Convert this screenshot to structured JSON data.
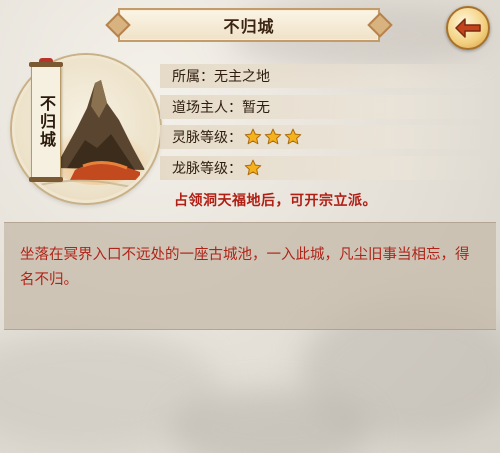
{
  "title": "不归城",
  "medallion": {
    "name": "不归城"
  },
  "info": {
    "owner_label": "所属：",
    "owner_value": "无主之地",
    "master_label": "道场主人：",
    "master_value": "暂无",
    "spirit_label": "灵脉等级：",
    "spirit_stars": 3,
    "dragon_label": "龙脉等级：",
    "dragon_stars": 1
  },
  "notice": "占领洞天福地后，可开宗立派。",
  "description": "坐落在冥界入口不远处的一座古城池，一入此城，凡尘旧事当相忘，得名不归。",
  "colors": {
    "accent_red": "#b11f14",
    "star_gold": "#f5b21c",
    "banner_border": "#c49b6a"
  },
  "icons": {
    "back": "back-arrow-icon",
    "star": "star-icon"
  }
}
